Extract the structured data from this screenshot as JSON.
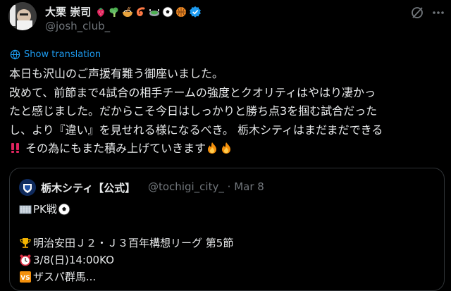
{
  "author": {
    "name": "大栗 崇司",
    "handle": "@josh_club_",
    "emoji_icons": [
      "strawberry-icon",
      "broccoli-icon",
      "ramen-icon",
      "shrimp-icon",
      "stadium-icon",
      "soccer-ball-icon",
      "basketball-icon"
    ],
    "verified": true
  },
  "translate_label": "Show translation",
  "post_lines": [
    "本日も沢山のご声援有難う御座いました。",
    "改めて、前節まで4試合の相手チームの強度とクオリティはやはり凄かっ",
    "たと感じました。だからこそ今日はしっかりと勝ち点3を掴む試合だった",
    "し、より『違い』を見せれる様になるべき。 栃木シティはまだまだできる",
    " その為にもまた積み上げていきます"
  ],
  "quote": {
    "name": "栃木シティ【公式】",
    "handle": "@tochigi_city_",
    "separator": "·",
    "date": "Mar 8",
    "lines": [
      "PK戦",
      "",
      "明治安田Ｊ２・Ｊ３百年構想リーグ 第5節",
      "3/8(日)14:00KO",
      "ザスパ群馬..."
    ]
  },
  "colors": {
    "background": "#000000",
    "text": "#e7e9ea",
    "secondary": "#71767b",
    "link": "#1d9bf0",
    "border": "#2f3336"
  }
}
